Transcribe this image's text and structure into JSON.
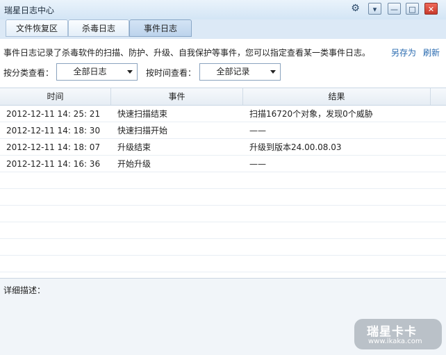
{
  "window": {
    "title": "瑞星日志中心",
    "controls": {
      "settings": "⚙",
      "menu": "▾",
      "minimize": "—",
      "maximize": "□",
      "close": "✕"
    }
  },
  "tabs": [
    {
      "label": "文件恢复区",
      "active": false
    },
    {
      "label": "杀毒日志",
      "active": false
    },
    {
      "label": "事件日志",
      "active": true
    }
  ],
  "toolbar": {
    "description": "事件日志记录了杀毒软件的扫描、防护、升级、自我保护等事件，您可以指定查看某一类事件日志。",
    "save_as": "另存为",
    "refresh": "刷新"
  },
  "filters": {
    "category_label": "按分类查看：",
    "category_value": "全部日志",
    "time_label": "按时间查看：",
    "time_value": "全部记录"
  },
  "table": {
    "columns": [
      "时间",
      "事件",
      "结果"
    ],
    "rows": [
      [
        "2012-12-11 14: 25: 21",
        "快速扫描结束",
        "扫描16720个对象，发现0个威胁"
      ],
      [
        "2012-12-11 14: 18: 30",
        "快速扫描开始",
        "——"
      ],
      [
        "2012-12-11 14: 18: 07",
        "升级结束",
        "升级到版本24.00.08.03"
      ],
      [
        "2012-12-11 14: 16: 36",
        "开始升级",
        "——"
      ]
    ]
  },
  "detail": {
    "label": "详细描述："
  },
  "watermark": {
    "title": "瑞星卡卡",
    "url": "www.ikaka.com"
  },
  "colors": {
    "link": "#2a6bb0",
    "titlebar": "#d3e5f5",
    "close": "#c7392b"
  }
}
